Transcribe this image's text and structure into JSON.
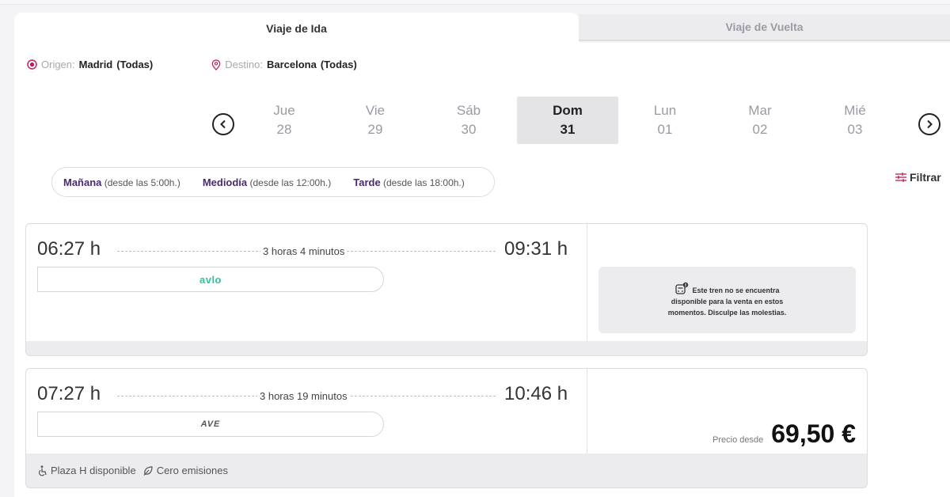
{
  "tabs": {
    "outbound": "Viaje de Ida",
    "return": "Viaje de Vuelta"
  },
  "route": {
    "origin_label": "Origen:",
    "origin_value": "Madrid",
    "origin_scope": "(Todas)",
    "destination_label": "Destino:",
    "destination_value": "Barcelona",
    "destination_scope": "(Todas)"
  },
  "dates": [
    {
      "weekday": "Jue",
      "day": "28"
    },
    {
      "weekday": "Vie",
      "day": "29"
    },
    {
      "weekday": "Sáb",
      "day": "30"
    },
    {
      "weekday": "Dom",
      "day": "31",
      "selected": true
    },
    {
      "weekday": "Lun",
      "day": "01"
    },
    {
      "weekday": "Mar",
      "day": "02"
    },
    {
      "weekday": "Mié",
      "day": "03"
    }
  ],
  "time_filters": [
    {
      "name": "Mañana",
      "range": "(desde las 5:00h.)"
    },
    {
      "name": "Mediodía",
      "range": "(desde las 12:00h.)"
    },
    {
      "name": "Tarde",
      "range": "(desde las 18:00h.)"
    }
  ],
  "filter_label": "Filtrar",
  "trains": [
    {
      "departure": "06:27 h",
      "arrival": "09:31 h",
      "duration": "3 horas 4 minutos",
      "brand": "avlo",
      "unavailable_text_1": "Este tren no se encuentra",
      "unavailable_text_2": "disponible para la venta en estos",
      "unavailable_text_3": "momentos. Disculpe las molestias."
    },
    {
      "departure": "07:27 h",
      "arrival": "10:46 h",
      "duration": "3 horas 19 minutos",
      "brand": "AVE",
      "price_label": "Precio desde",
      "price": "69,50 €",
      "feature_1": "Plaza H disponible",
      "feature_2": "Cero emisiones"
    }
  ],
  "colors": {
    "accent": "#c2185b",
    "brand_purple": "#4a2a6e",
    "avlo_green": "#2ec4a0"
  }
}
